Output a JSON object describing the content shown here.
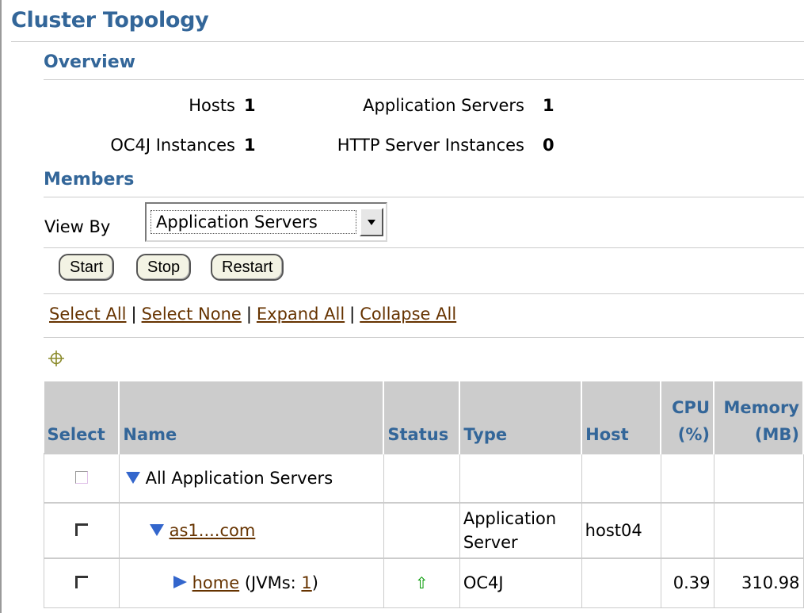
{
  "page": {
    "title": "Cluster Topology"
  },
  "overview": {
    "heading": "Overview",
    "hosts_label": "Hosts",
    "hosts_value": "1",
    "appservers_label": "Application Servers",
    "appservers_value": "1",
    "oc4j_label": "OC4J Instances",
    "oc4j_value": "1",
    "http_label": "HTTP Server Instances",
    "http_value": "0"
  },
  "members": {
    "heading": "Members",
    "viewby_label": "View By",
    "viewby_value": "Application Servers",
    "buttons": {
      "start": "Start",
      "stop": "Stop",
      "restart": "Restart"
    },
    "links": {
      "select_all": "Select All",
      "select_none": "Select None",
      "expand_all": "Expand All",
      "collapse_all": "Collapse All"
    },
    "table": {
      "headers": {
        "select": "Select",
        "name": "Name",
        "status": "Status",
        "type": "Type",
        "host": "Host",
        "cpu_1": "CPU",
        "cpu_2": "(%)",
        "mem_1": "Memory",
        "mem_2": "(MB)"
      },
      "rows": [
        {
          "name": "All Application Servers"
        },
        {
          "name": "as1....com",
          "type_1": "Application",
          "type_2": "Server",
          "host": "host04"
        },
        {
          "name": "home",
          "jvm_prefix": "(JVMs: ",
          "jvm_count": "1",
          "jvm_suffix": ")",
          "type": "OC4J",
          "cpu": "0.39",
          "memory": "310.98"
        }
      ]
    }
  },
  "colors": {
    "heading": "#336699",
    "link": "#663300",
    "header_bg": "#cccccc",
    "tree_icon": "#3366cc",
    "status_up": "#009900"
  }
}
